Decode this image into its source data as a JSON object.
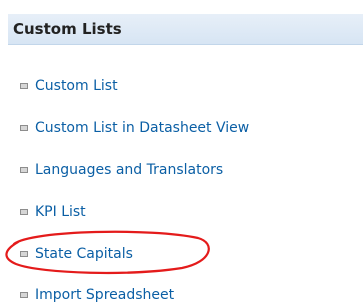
{
  "panel": {
    "title": "Custom Lists"
  },
  "colors": {
    "header_bg": "#dbe7f5",
    "link": "#0b5fa5",
    "bullet": "#d6d6d6",
    "annotation": "#e41b1b"
  },
  "items": [
    {
      "label": "Custom List",
      "icon": "square-bullet-icon"
    },
    {
      "label": "Custom List in Datasheet View",
      "icon": "square-bullet-icon"
    },
    {
      "label": "Languages and Translators",
      "icon": "square-bullet-icon"
    },
    {
      "label": "KPI List",
      "icon": "square-bullet-icon"
    },
    {
      "label": "State Capitals",
      "icon": "square-bullet-icon",
      "highlighted": true
    },
    {
      "label": "Import Spreadsheet",
      "icon": "square-bullet-icon"
    }
  ]
}
